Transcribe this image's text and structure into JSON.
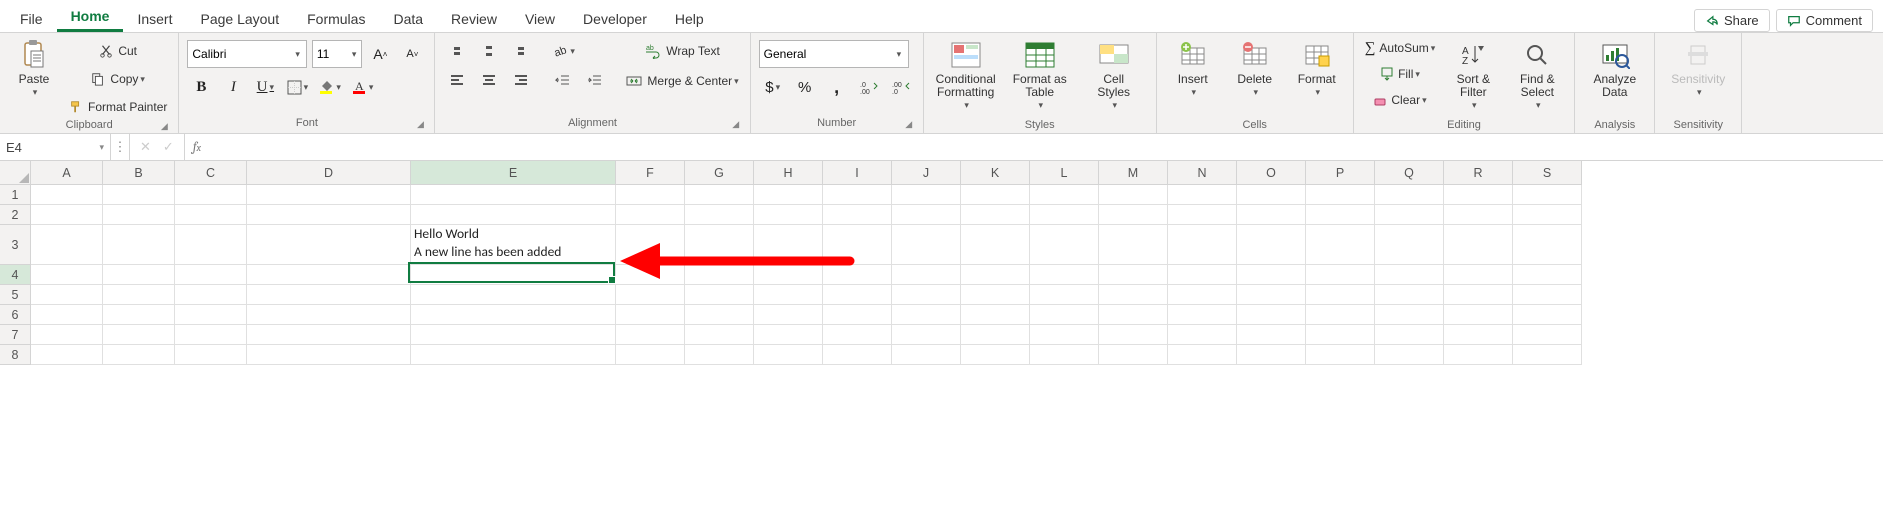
{
  "tabs": {
    "items": [
      "File",
      "Home",
      "Insert",
      "Page Layout",
      "Formulas",
      "Data",
      "Review",
      "View",
      "Developer",
      "Help"
    ],
    "active": 1
  },
  "topright": {
    "share": "Share",
    "comment": "Comment"
  },
  "clipboard": {
    "paste": "Paste",
    "cut": "Cut",
    "copy": "Copy",
    "fp": "Format Painter",
    "label": "Clipboard"
  },
  "font": {
    "name": "Calibri",
    "size": "11",
    "label": "Font"
  },
  "alignment": {
    "wrap": "Wrap Text",
    "merge": "Merge & Center",
    "label": "Alignment"
  },
  "number": {
    "format": "General",
    "label": "Number"
  },
  "styles": {
    "cond": "Conditional\nFormatting",
    "fat": "Format as\nTable",
    "cell": "Cell\nStyles",
    "label": "Styles"
  },
  "cells": {
    "insert_": "Insert",
    "delete_": "Delete",
    "format_": "Format",
    "label": "Cells"
  },
  "editing": {
    "sum": "AutoSum",
    "fill": "Fill",
    "clear": "Clear",
    "sort": "Sort &\nFilter",
    "find": "Find &\nSelect",
    "label": "Editing"
  },
  "analysis": {
    "analyze": "Analyze\nData",
    "label": "Analysis"
  },
  "sensitivity": {
    "sens": "Sensitivity",
    "label": "Sensitivity"
  },
  "namebox": "E4",
  "formula": "",
  "columns": [
    "A",
    "B",
    "C",
    "D",
    "E",
    "F",
    "G",
    "H",
    "I",
    "J",
    "K",
    "L",
    "M",
    "N",
    "O",
    "P",
    "Q",
    "R",
    "S"
  ],
  "rows": [
    "1",
    "2",
    "3",
    "4",
    "5",
    "6",
    "7",
    "8"
  ],
  "row3_height": 40,
  "cellE3_line1": "Hello World",
  "cellE3_line2": "A new line has been added",
  "selected": {
    "col": "E",
    "row": "4"
  }
}
